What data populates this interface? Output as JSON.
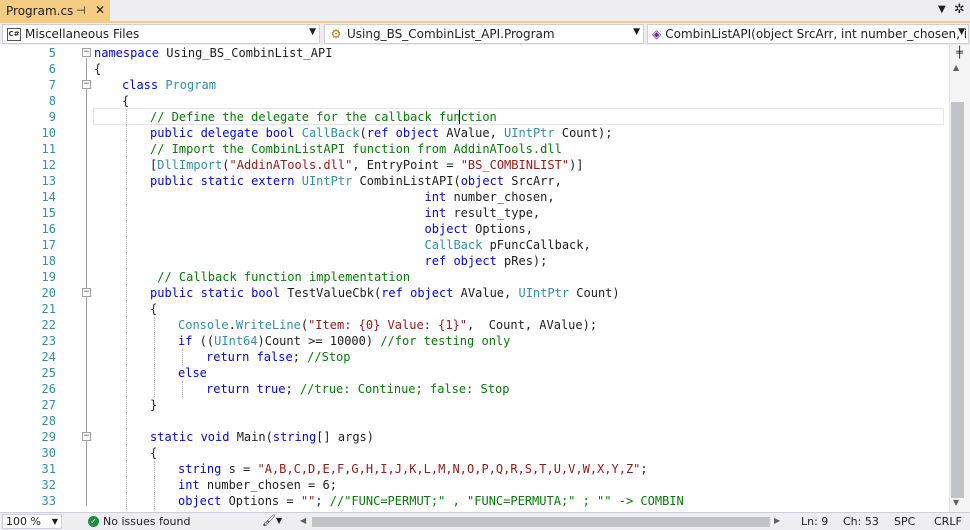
{
  "tab": {
    "title": "Program.cs",
    "pin_icon": "pin-icon",
    "close_icon": "close-icon"
  },
  "tab_strip": {
    "dropdown_icon": "dropdown-icon",
    "settings_icon": "gear-icon"
  },
  "navbar": {
    "project": "Miscellaneous Files",
    "type": "Using_BS_CombinList_API.Program",
    "member": "CombinListAPI(object SrcArr, int number_chosen, int r"
  },
  "editor": {
    "lines": [
      {
        "n": "5",
        "i": 0,
        "fold": "minus",
        "t": [
          [
            "kw",
            "namespace"
          ],
          [
            "pl",
            " Using_BS_CombinList_API"
          ]
        ]
      },
      {
        "n": "6",
        "i": 0,
        "t": [
          [
            "pl",
            "{"
          ]
        ]
      },
      {
        "n": "7",
        "i": 1,
        "fold": "minus",
        "t": [
          [
            "kw",
            "class"
          ],
          [
            "pl",
            " "
          ],
          [
            "ty",
            "Program"
          ]
        ]
      },
      {
        "n": "8",
        "i": 1,
        "t": [
          [
            "pl",
            "{"
          ]
        ]
      },
      {
        "n": "9",
        "i": 2,
        "t": [
          [
            "cm",
            "// Define the delegate for the callback function"
          ]
        ]
      },
      {
        "n": "10",
        "i": 2,
        "t": [
          [
            "kw",
            "public delegate bool"
          ],
          [
            "pl",
            " "
          ],
          [
            "ty",
            "CallBack"
          ],
          [
            "pl",
            "("
          ],
          [
            "kw",
            "ref object"
          ],
          [
            "pl",
            " AValue, "
          ],
          [
            "ty",
            "UIntPtr"
          ],
          [
            "pl",
            " Count);"
          ]
        ]
      },
      {
        "n": "11",
        "i": 2,
        "t": [
          [
            "cm",
            "// Import the CombinListAPI function from AddinATools.dll"
          ]
        ]
      },
      {
        "n": "12",
        "i": 2,
        "t": [
          [
            "pl",
            "["
          ],
          [
            "ty",
            "DllImport"
          ],
          [
            "pl",
            "("
          ],
          [
            "st",
            "\"AddinATools.dll\""
          ],
          [
            "pl",
            ", EntryPoint = "
          ],
          [
            "st",
            "\"BS_COMBINLIST\""
          ],
          [
            "pl",
            ")]"
          ]
        ]
      },
      {
        "n": "13",
        "i": 2,
        "t": [
          [
            "kw",
            "public static extern"
          ],
          [
            "pl",
            " "
          ],
          [
            "ty",
            "UIntPtr"
          ],
          [
            "pl",
            " CombinListAPI("
          ],
          [
            "kw",
            "object"
          ],
          [
            "pl",
            " SrcArr,"
          ]
        ]
      },
      {
        "n": "14",
        "i": 2,
        "t": [
          [
            "pl",
            "                                      "
          ],
          [
            "kw",
            "int"
          ],
          [
            "pl",
            " number_chosen,"
          ]
        ]
      },
      {
        "n": "15",
        "i": 2,
        "t": [
          [
            "pl",
            "                                      "
          ],
          [
            "kw",
            "int"
          ],
          [
            "pl",
            " result_type,"
          ]
        ]
      },
      {
        "n": "16",
        "i": 2,
        "t": [
          [
            "pl",
            "                                      "
          ],
          [
            "kw",
            "object"
          ],
          [
            "pl",
            " Options,"
          ]
        ]
      },
      {
        "n": "17",
        "i": 2,
        "t": [
          [
            "pl",
            "                                      "
          ],
          [
            "ty",
            "CallBack"
          ],
          [
            "pl",
            " pFuncCallback,"
          ]
        ]
      },
      {
        "n": "18",
        "i": 2,
        "t": [
          [
            "pl",
            "                                      "
          ],
          [
            "kw",
            "ref object"
          ],
          [
            "pl",
            " pRes);"
          ]
        ]
      },
      {
        "n": "19",
        "i": 2,
        "t": [
          [
            "cm",
            " // Callback function implementation"
          ]
        ]
      },
      {
        "n": "20",
        "i": 2,
        "fold": "minus",
        "t": [
          [
            "kw",
            "public static bool"
          ],
          [
            "pl",
            " TestValueCbk("
          ],
          [
            "kw",
            "ref object"
          ],
          [
            "pl",
            " AValue, "
          ],
          [
            "ty",
            "UIntPtr"
          ],
          [
            "pl",
            " Count)"
          ]
        ]
      },
      {
        "n": "21",
        "i": 2,
        "t": [
          [
            "pl",
            "{"
          ]
        ]
      },
      {
        "n": "22",
        "i": 3,
        "t": [
          [
            "ty",
            "Console"
          ],
          [
            "pl",
            "."
          ],
          [
            "ty",
            "WriteLine"
          ],
          [
            "pl",
            "("
          ],
          [
            "st",
            "\"Item: {0} Value: {1}\""
          ],
          [
            "pl",
            ",  Count, AValue);"
          ]
        ]
      },
      {
        "n": "23",
        "i": 3,
        "t": [
          [
            "kw",
            "if"
          ],
          [
            "pl",
            " (("
          ],
          [
            "ty",
            "UInt64"
          ],
          [
            "pl",
            ")Count >= 10000) "
          ],
          [
            "cm",
            "//for testing only"
          ]
        ]
      },
      {
        "n": "24",
        "i": 4,
        "t": [
          [
            "kw",
            "return false"
          ],
          [
            "pl",
            "; "
          ],
          [
            "cm",
            "//Stop"
          ]
        ]
      },
      {
        "n": "25",
        "i": 3,
        "t": [
          [
            "kw",
            "else"
          ]
        ]
      },
      {
        "n": "26",
        "i": 4,
        "t": [
          [
            "kw",
            "return true"
          ],
          [
            "pl",
            "; "
          ],
          [
            "cm",
            "//true: Continue; false: Stop"
          ]
        ]
      },
      {
        "n": "27",
        "i": 2,
        "t": [
          [
            "pl",
            "}"
          ]
        ]
      },
      {
        "n": "28",
        "i": 2,
        "t": []
      },
      {
        "n": "29",
        "i": 2,
        "fold": "minus",
        "t": [
          [
            "kw",
            "static void"
          ],
          [
            "pl",
            " Main("
          ],
          [
            "kw",
            "string"
          ],
          [
            "pl",
            "[] args)"
          ]
        ]
      },
      {
        "n": "30",
        "i": 2,
        "t": [
          [
            "pl",
            "{"
          ]
        ]
      },
      {
        "n": "31",
        "i": 3,
        "t": [
          [
            "kw",
            "string"
          ],
          [
            "pl",
            " s = "
          ],
          [
            "st",
            "\"A,B,C,D,E,F,G,H,I,J,K,L,M,N,O,P,Q,R,S,T,U,V,W,X,Y,Z\""
          ],
          [
            "pl",
            ";"
          ]
        ]
      },
      {
        "n": "32",
        "i": 3,
        "t": [
          [
            "kw",
            "int"
          ],
          [
            "pl",
            " number_chosen = 6;"
          ]
        ]
      },
      {
        "n": "33",
        "i": 3,
        "t": [
          [
            "kw",
            "object"
          ],
          [
            "pl",
            " Options = "
          ],
          [
            "st",
            "\"\""
          ],
          [
            "pl",
            "; "
          ],
          [
            "cm",
            "//\"FUNC=PERMUT;\" , \"FUNC=PERMUTA;\" ; \"\" -> COMBIN"
          ]
        ]
      }
    ]
  },
  "status": {
    "zoom": "100 %",
    "issues": "No issues found",
    "ln": "Ln: 9",
    "ch": "Ch: 53",
    "spc": "SPC",
    "crlf": "CRLF"
  }
}
